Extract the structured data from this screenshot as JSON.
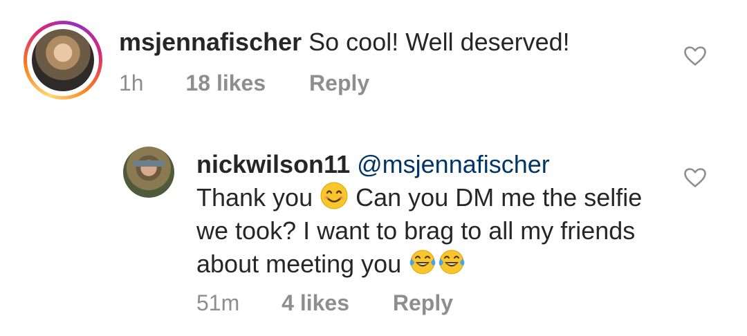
{
  "comments": [
    {
      "username": "msjennafischer",
      "text": "So cool! Well deserved!",
      "time": "1h",
      "likes": "18 likes",
      "reply_label": "Reply",
      "has_story_ring": true
    },
    {
      "username": "nickwilson11",
      "mention": "@msjennafischer",
      "text_part1": "Thank you",
      "text_part2": "Can you DM me the selfie we took? I want to brag to all my friends about meeting you",
      "emojis": [
        "smiling-face-emoji",
        "tears-of-joy-emoji",
        "tears-of-joy-emoji"
      ],
      "time": "51m",
      "likes": "4 likes",
      "reply_label": "Reply"
    }
  ],
  "colors": {
    "text": "#262626",
    "secondary": "#8e8e8e",
    "mention": "#003569",
    "story_ring": [
      "#feda75",
      "#fa7e1e",
      "#d62976",
      "#962fbf"
    ]
  },
  "icons": {
    "like": "heart-outline-icon"
  }
}
